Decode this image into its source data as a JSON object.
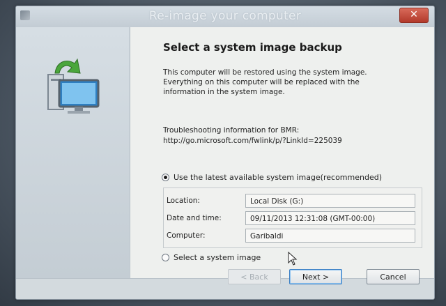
{
  "window": {
    "title": "Re-image your computer",
    "close_glyph": "✕"
  },
  "content": {
    "heading": "Select a system image backup",
    "description_line1": "This computer will be restored using the system image.",
    "description_line2": "Everything on this computer will be replaced with the",
    "description_line3": "information in the system image.",
    "troubleshooting_label": "Troubleshooting information for BMR:",
    "troubleshooting_url": "http://go.microsoft.com/fwlink/p/?LinkId=225039"
  },
  "options": {
    "latest": {
      "label": "Use the latest available system image(recommended)",
      "selected": true
    },
    "select": {
      "label": "Select a system image",
      "selected": false
    }
  },
  "details": {
    "location_label": "Location:",
    "location_value": "Local Disk (G:)",
    "datetime_label": "Date and time:",
    "datetime_value": "09/11/2013 12:31:08 (GMT-00:00)",
    "computer_label": "Computer:",
    "computer_value": "Garibaldi"
  },
  "buttons": {
    "back": "< Back",
    "next": "Next >",
    "cancel": "Cancel"
  },
  "icons": {
    "sidebar": "system-image-restore-icon",
    "cursor": "mouse-pointer-icon"
  }
}
